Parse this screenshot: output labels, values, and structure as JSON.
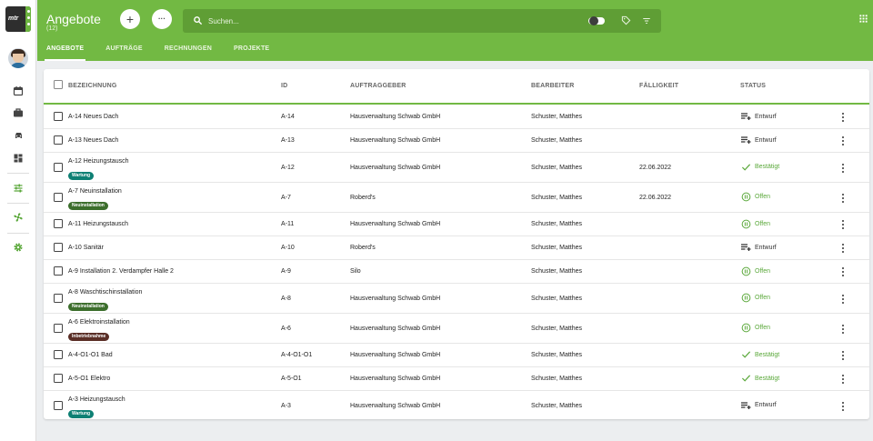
{
  "logo": {
    "text": "mtr"
  },
  "header": {
    "title": "Angebote",
    "count": "(12)",
    "add_label": "+",
    "more_label": "···",
    "search_placeholder": "Suchen..."
  },
  "tabs": [
    {
      "label": "ANGEBOTE"
    },
    {
      "label": "AUFTRÄGE"
    },
    {
      "label": "RECHNUNGEN"
    },
    {
      "label": "PROJEKTE"
    }
  ],
  "nav_icons": [
    "calendar-icon",
    "briefcase-icon",
    "car-icon",
    "dashboard-icon",
    "sliders-icon",
    "fan-icon",
    "gear-icon"
  ],
  "columns": {
    "name": "BEZEICHNUNG",
    "id": "ID",
    "client": "AUFTRAGGEBER",
    "editor": "BEARBEITER",
    "due": "FÄLLIGKEIT",
    "status": "STATUS"
  },
  "colors": {
    "brand": "#72b943",
    "badge_wartung": "#0e8074",
    "badge_neuinstallation": "#3c6e2c",
    "badge_inbetriebnahme": "#5a2e26",
    "status_confirmed": "#5aa83a",
    "status_open": "#5aa83a",
    "status_draft": "#333333"
  },
  "rows": [
    {
      "name": "A-14 Neues Dach",
      "badge": "",
      "id": "A-14",
      "client": "Hausverwaltung Schwab GmbH",
      "editor": "Schuster, Matthes",
      "due": "",
      "status": "Entwurf",
      "status_type": "draft"
    },
    {
      "name": "A-13 Neues Dach",
      "badge": "",
      "id": "A-13",
      "client": "Hausverwaltung Schwab GmbH",
      "editor": "Schuster, Matthes",
      "due": "",
      "status": "Entwurf",
      "status_type": "draft"
    },
    {
      "name": "A-12 Heizungstausch",
      "badge": "Wartung",
      "id": "A-12",
      "client": "Hausverwaltung Schwab GmbH",
      "editor": "Schuster, Matthes",
      "due": "22.06.2022",
      "status": "Bestätigt",
      "status_type": "confirmed"
    },
    {
      "name": "A-7 Neuinstallation",
      "badge": "Neuinstallation",
      "id": "A-7",
      "client": "Roberd's",
      "editor": "Schuster, Matthes",
      "due": "22.06.2022",
      "status": "Offen",
      "status_type": "open"
    },
    {
      "name": "A-11 Heizungstausch",
      "badge": "",
      "id": "A-11",
      "client": "Hausverwaltung Schwab GmbH",
      "editor": "Schuster, Matthes",
      "due": "",
      "status": "Offen",
      "status_type": "open"
    },
    {
      "name": "A-10 Sanitär",
      "badge": "",
      "id": "A-10",
      "client": "Roberd's",
      "editor": "Schuster, Matthes",
      "due": "",
      "status": "Entwurf",
      "status_type": "draft"
    },
    {
      "name": "A-9 Installation 2. Verdampfer Halle 2",
      "badge": "",
      "id": "A-9",
      "client": "Silo",
      "editor": "Schuster, Matthes",
      "due": "",
      "status": "Offen",
      "status_type": "open"
    },
    {
      "name": "A-8 Waschtischinstallation",
      "badge": "Neuinstallation",
      "id": "A-8",
      "client": "Hausverwaltung Schwab GmbH",
      "editor": "Schuster, Matthes",
      "due": "",
      "status": "Offen",
      "status_type": "open"
    },
    {
      "name": "A-6 Elektroinstallation",
      "badge": "Inbetriebnahme",
      "id": "A-6",
      "client": "Hausverwaltung Schwab GmbH",
      "editor": "Schuster, Matthes",
      "due": "",
      "status": "Offen",
      "status_type": "open"
    },
    {
      "name": "A-4-O1-O1 Bad",
      "badge": "",
      "id": "A-4-O1-O1",
      "client": "Hausverwaltung Schwab GmbH",
      "editor": "Schuster, Matthes",
      "due": "",
      "status": "Bestätigt",
      "status_type": "confirmed"
    },
    {
      "name": "A-5-O1 Elektro",
      "badge": "",
      "id": "A-5-O1",
      "client": "Hausverwaltung Schwab GmbH",
      "editor": "Schuster, Matthes",
      "due": "",
      "status": "Bestätigt",
      "status_type": "confirmed"
    },
    {
      "name": "A-3 Heizungstausch",
      "badge": "Wartung",
      "id": "A-3",
      "client": "Hausverwaltung Schwab GmbH",
      "editor": "Schuster, Matthes",
      "due": "",
      "status": "Entwurf",
      "status_type": "draft"
    }
  ]
}
